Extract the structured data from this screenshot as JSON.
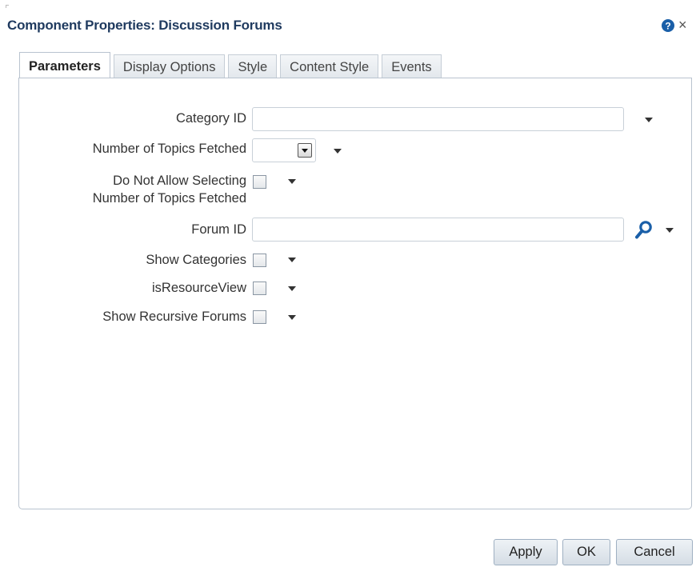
{
  "dialog": {
    "title": "Component Properties: Discussion Forums",
    "help_icon": "help-icon",
    "close_glyph": "×"
  },
  "tabs": [
    {
      "label": "Parameters",
      "active": true
    },
    {
      "label": "Display Options",
      "active": false
    },
    {
      "label": "Style",
      "active": false
    },
    {
      "label": "Content Style",
      "active": false
    },
    {
      "label": "Events",
      "active": false
    }
  ],
  "params": {
    "category_id": {
      "label": "Category ID",
      "value": ""
    },
    "topics_fetched": {
      "label": "Number of Topics Fetched",
      "value": ""
    },
    "no_select_topics": {
      "label_line1": "Do Not Allow Selecting",
      "label_line2": "Number of Topics Fetched",
      "checked": false
    },
    "forum_id": {
      "label": "Forum ID",
      "value": ""
    },
    "show_categories": {
      "label": "Show Categories",
      "checked": false
    },
    "is_resource_view": {
      "label": "isResourceView",
      "checked": false
    },
    "show_recursive_forums": {
      "label": "Show Recursive Forums",
      "checked": false
    }
  },
  "buttons": {
    "apply": "Apply",
    "ok": "OK",
    "cancel": "Cancel"
  },
  "colors": {
    "title": "#1f3a5f",
    "help_icon": "#1a5fa8",
    "search_icon": "#1a5fa8"
  }
}
